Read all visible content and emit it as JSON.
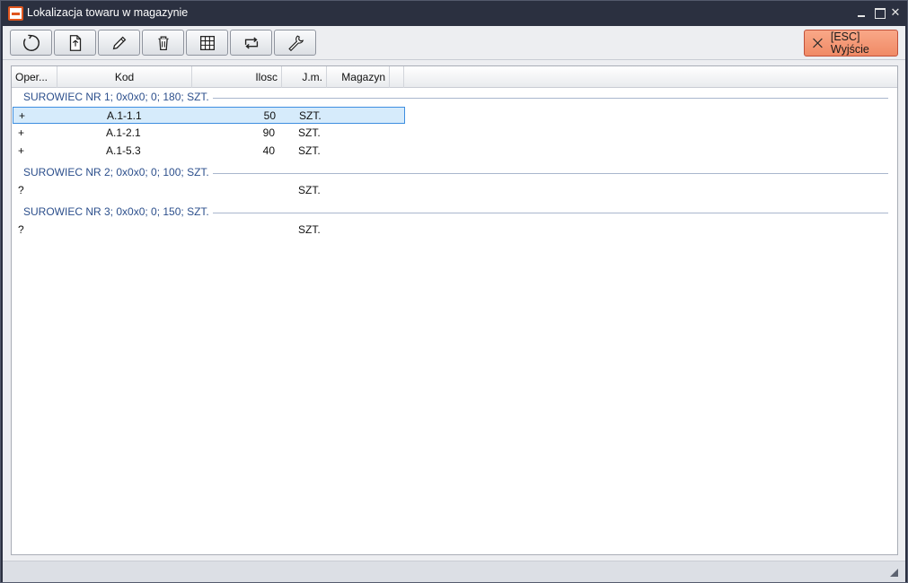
{
  "window": {
    "title": "Lokalizacja towaru w magazynie",
    "controls": {
      "minimize": "",
      "maximize": "",
      "close": "✕"
    }
  },
  "toolbar": {
    "buttons": [
      {
        "name": "refresh-button",
        "icon": "refresh-icon"
      },
      {
        "name": "new-document-button",
        "icon": "new-document-icon"
      },
      {
        "name": "edit-button",
        "icon": "pencil-icon"
      },
      {
        "name": "delete-button",
        "icon": "trash-icon"
      },
      {
        "name": "grid-button",
        "icon": "grid-icon"
      },
      {
        "name": "repeat-button",
        "icon": "repeat-icon"
      },
      {
        "name": "settings-button",
        "icon": "wrench-icon"
      }
    ],
    "exit_label": "[ESC] Wyjście",
    "exit_accent": "#f08a66"
  },
  "grid": {
    "columns": [
      "Oper...",
      "Kod",
      "Ilosc",
      "J.m.",
      "Magazyn"
    ],
    "groups": [
      {
        "label": "SUROWIEC NR 1; 0x0x0; 0; 180; SZT.",
        "rows": [
          {
            "oper": "+",
            "kod": "A.1-1.1",
            "ilosc": "50",
            "jm": "SZT.",
            "magazyn": "",
            "selected": true
          },
          {
            "oper": "+",
            "kod": "A.1-2.1",
            "ilosc": "90",
            "jm": "SZT.",
            "magazyn": ""
          },
          {
            "oper": "+",
            "kod": "A.1-5.3",
            "ilosc": "40",
            "jm": "SZT.",
            "magazyn": ""
          }
        ]
      },
      {
        "label": "SUROWIEC NR 2; 0x0x0; 0; 100; SZT.",
        "rows": [
          {
            "oper": "?",
            "kod": "",
            "ilosc": "",
            "jm": "SZT.",
            "magazyn": ""
          }
        ]
      },
      {
        "label": "SUROWIEC NR 3; 0x0x0; 0; 150; SZT.",
        "rows": [
          {
            "oper": "?",
            "kod": "",
            "ilosc": "",
            "jm": "SZT.",
            "magazyn": ""
          }
        ]
      }
    ]
  },
  "colors": {
    "titlebar": "#2b3040",
    "group_text": "#2c4f8c",
    "selection": "#d6ebfb",
    "selection_border": "#3d8ee0"
  }
}
